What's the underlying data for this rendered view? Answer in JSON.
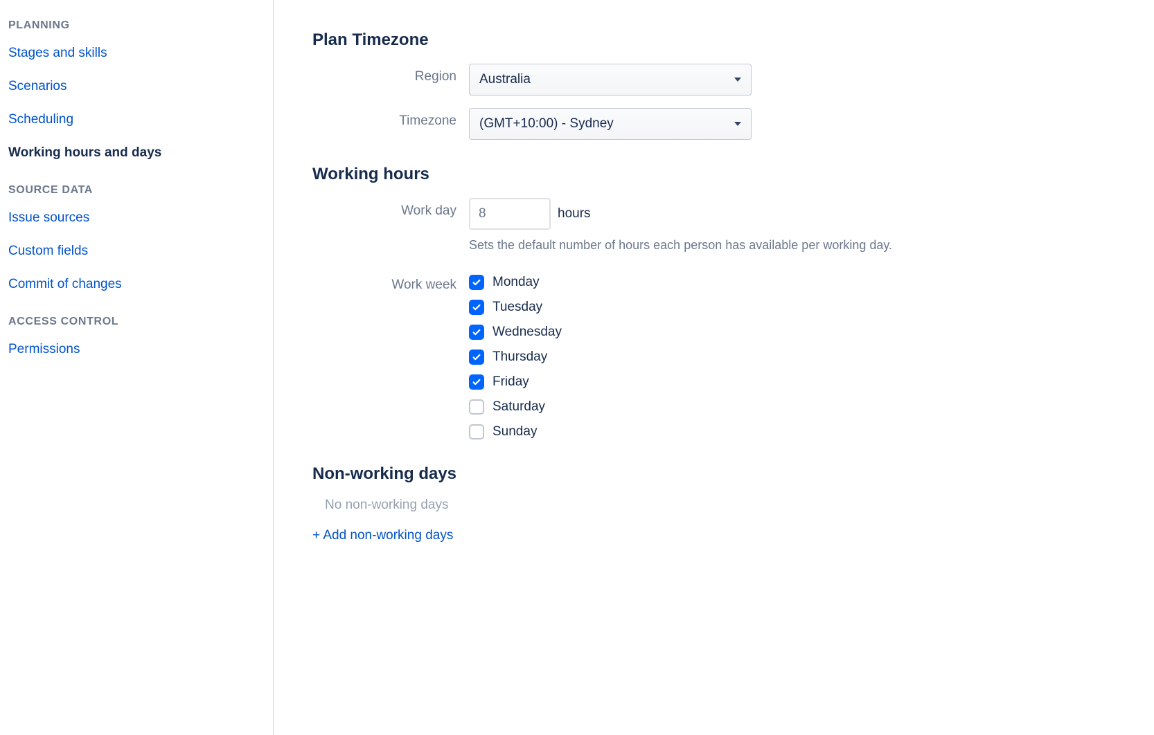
{
  "sidebar": {
    "sections": [
      {
        "header": "PLANNING",
        "items": [
          {
            "label": "Stages and skills",
            "active": false
          },
          {
            "label": "Scenarios",
            "active": false
          },
          {
            "label": "Scheduling",
            "active": false
          },
          {
            "label": "Working hours and days",
            "active": true
          }
        ]
      },
      {
        "header": "SOURCE DATA",
        "items": [
          {
            "label": "Issue sources",
            "active": false
          },
          {
            "label": "Custom fields",
            "active": false
          },
          {
            "label": "Commit of changes",
            "active": false
          }
        ]
      },
      {
        "header": "ACCESS CONTROL",
        "items": [
          {
            "label": "Permissions",
            "active": false
          }
        ]
      }
    ]
  },
  "main": {
    "timezone_section": {
      "title": "Plan Timezone",
      "region_label": "Region",
      "region_value": "Australia",
      "timezone_label": "Timezone",
      "timezone_value": "(GMT+10:00) - Sydney"
    },
    "working_hours_section": {
      "title": "Working hours",
      "workday_label": "Work day",
      "workday_value": "8",
      "workday_suffix": "hours",
      "workday_help": "Sets the default number of hours each person has available per working day.",
      "workweek_label": "Work week",
      "workweek_days": [
        {
          "label": "Monday",
          "checked": true
        },
        {
          "label": "Tuesday",
          "checked": true
        },
        {
          "label": "Wednesday",
          "checked": true
        },
        {
          "label": "Thursday",
          "checked": true
        },
        {
          "label": "Friday",
          "checked": true
        },
        {
          "label": "Saturday",
          "checked": false
        },
        {
          "label": "Sunday",
          "checked": false
        }
      ]
    },
    "non_working_section": {
      "title": "Non-working days",
      "empty_text": "No non-working days",
      "add_link": "+ Add non-working days"
    }
  }
}
